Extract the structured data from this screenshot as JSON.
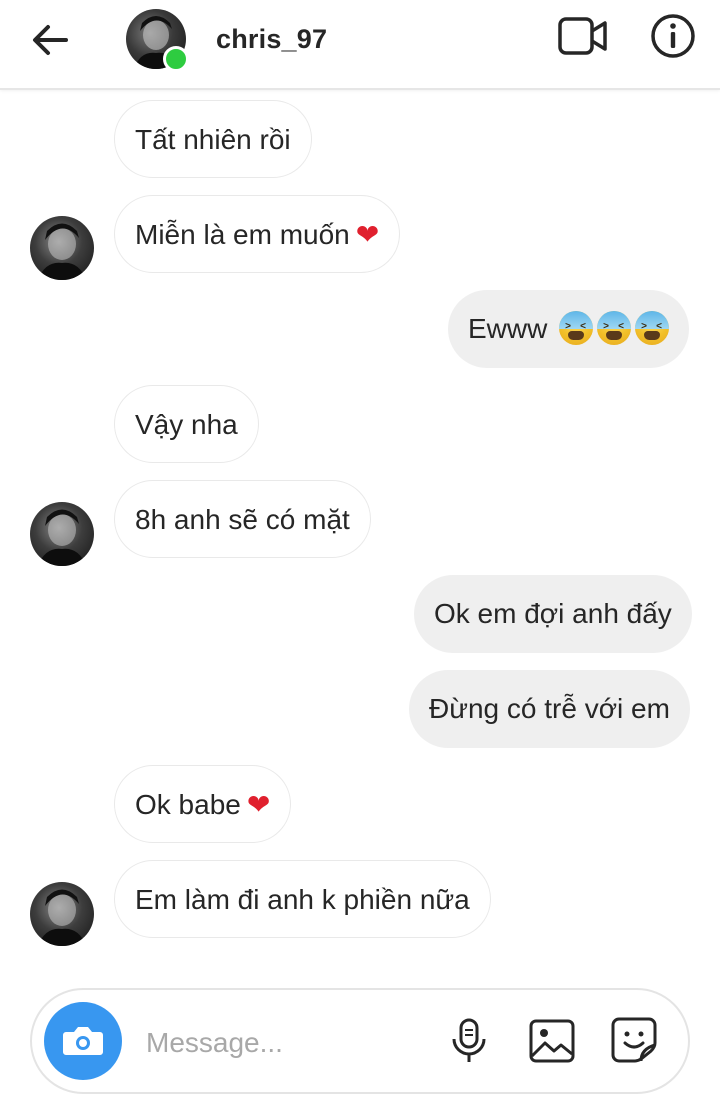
{
  "header": {
    "username": "chris_97",
    "back_icon": "arrow-left-icon",
    "video_icon": "video-camera-icon",
    "info_icon": "info-icon",
    "online_color": "#2ecc40"
  },
  "messages": [
    {
      "direction": "incoming",
      "text": "Tất nhiên rồi",
      "emoji": ""
    },
    {
      "direction": "incoming",
      "text": "Miễn là em muốn",
      "emoji": "heart"
    },
    {
      "direction": "outgoing",
      "text": "Ewww",
      "emoji": "tired-face x3"
    },
    {
      "direction": "incoming",
      "text": "Vậy nha",
      "emoji": ""
    },
    {
      "direction": "incoming",
      "text": "8h anh sẽ có mặt",
      "emoji": ""
    },
    {
      "direction": "outgoing",
      "text": "Ok em đợi anh đấy",
      "emoji": ""
    },
    {
      "direction": "outgoing",
      "text": "Đừng có trễ với em",
      "emoji": ""
    },
    {
      "direction": "incoming",
      "text": "Ok babe",
      "emoji": "heart"
    },
    {
      "direction": "incoming",
      "text": "Em làm đi anh k phiền nữa",
      "emoji": ""
    }
  ],
  "composer": {
    "placeholder": "Message...",
    "camera_icon": "camera-icon",
    "mic_icon": "microphone-icon",
    "gallery_icon": "image-icon",
    "sticker_icon": "sticker-icon",
    "accent_color": "#3897f0"
  }
}
